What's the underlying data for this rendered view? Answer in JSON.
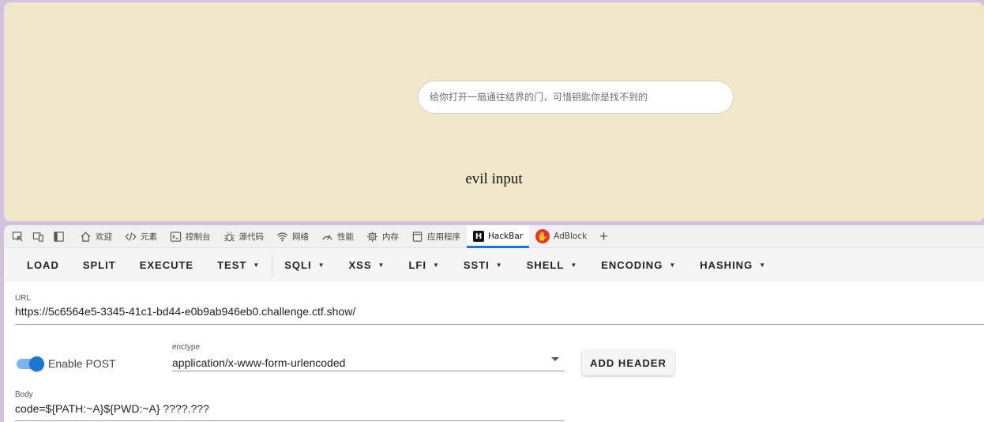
{
  "page": {
    "search_placeholder": "给你打开一扇通往结界的门，可惜钥匙你是找不到的",
    "evil_text": "evil input"
  },
  "devtools": {
    "tabs": [
      {
        "label": "欢迎",
        "icon": "home-icon"
      },
      {
        "label": "元素",
        "icon": "code-icon"
      },
      {
        "label": "控制台",
        "icon": "console-icon"
      },
      {
        "label": "源代码",
        "icon": "bug-icon"
      },
      {
        "label": "网络",
        "icon": "wifi-icon"
      },
      {
        "label": "性能",
        "icon": "gauge-icon"
      },
      {
        "label": "内存",
        "icon": "chip-icon"
      },
      {
        "label": "应用程序",
        "icon": "app-icon"
      },
      {
        "label": "HackBar",
        "icon": "hackbar-logo-icon"
      },
      {
        "label": "AdBlock",
        "icon": "adblock-hand-icon"
      }
    ],
    "active_tab": "HackBar",
    "accent_color": "#1a73e8"
  },
  "hackbar": {
    "toolbar": {
      "load": "LOAD",
      "split": "SPLIT",
      "execute": "EXECUTE",
      "test": "TEST",
      "sqli": "SQLI",
      "xss": "XSS",
      "lfi": "LFI",
      "ssti": "SSTI",
      "shell": "SHELL",
      "encoding": "ENCODING",
      "hashing": "HASHING"
    },
    "url_label": "URL",
    "url_value": "https://5c6564e5-3345-41c1-bd44-e0b9ab946eb0.challenge.ctf.show/",
    "enable_post_label": "Enable POST",
    "enable_post_on": true,
    "enctype_label": "enctype",
    "enctype_value": "application/x-www-form-urlencoded",
    "add_header_label": "ADD HEADER",
    "body_label": "Body",
    "body_value": "code=${PATH:~A}${PWD:~A} ????.???"
  }
}
